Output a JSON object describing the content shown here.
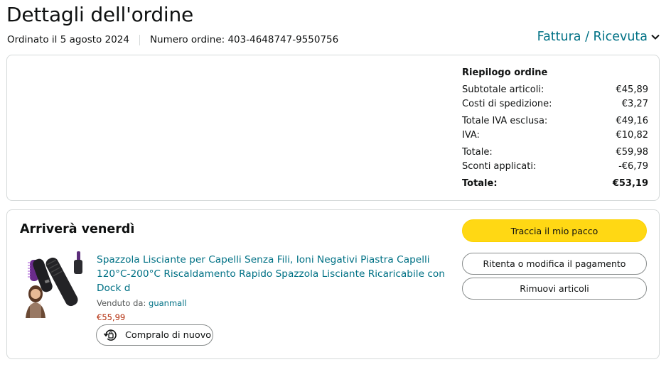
{
  "header": {
    "title": "Dettagli dell'ordine",
    "ordered_on": "Ordinato il 5 agosto 2024",
    "order_number": "Numero ordine: 403-4648747-9550756",
    "invoice_link": "Fattura / Ricevuta"
  },
  "summary": {
    "title": "Riepilogo ordine",
    "rows": [
      {
        "label": "Subtotale articoli:",
        "value": "€45,89"
      },
      {
        "label": "Costi di spedizione:",
        "value": "€3,27"
      },
      {
        "label": "Totale IVA esclusa:",
        "value": "€49,16"
      },
      {
        "label": "IVA:",
        "value": "€10,82"
      },
      {
        "label": "Totale:",
        "value": "€59,98"
      },
      {
        "label": "Sconti applicati:",
        "value": "-€6,79"
      },
      {
        "label": "Totale:",
        "value": "€53,19"
      }
    ]
  },
  "shipment": {
    "arrival": "Arriverà venerdì",
    "product": {
      "title": "Spazzola Lisciante per Capelli Senza Fili, Ioni Negativi Piastra Capelli 120°C-200°C Riscaldamento Rapido Spazzola Lisciante Ricaricabile con Dock d",
      "sold_by_label": "Venduto da:",
      "seller": "guanmall",
      "price": "€55,99",
      "buy_again": "Compralo di nuovo"
    },
    "actions": {
      "track": "Traccia il mio pacco",
      "retry_payment": "Ritenta o modifica il pagamento",
      "remove": "Rimuovi articoli"
    }
  },
  "colors": {
    "link": "#007185",
    "price": "#B12704",
    "primary_button": "#FFD814",
    "border": "#D5D9D9"
  }
}
